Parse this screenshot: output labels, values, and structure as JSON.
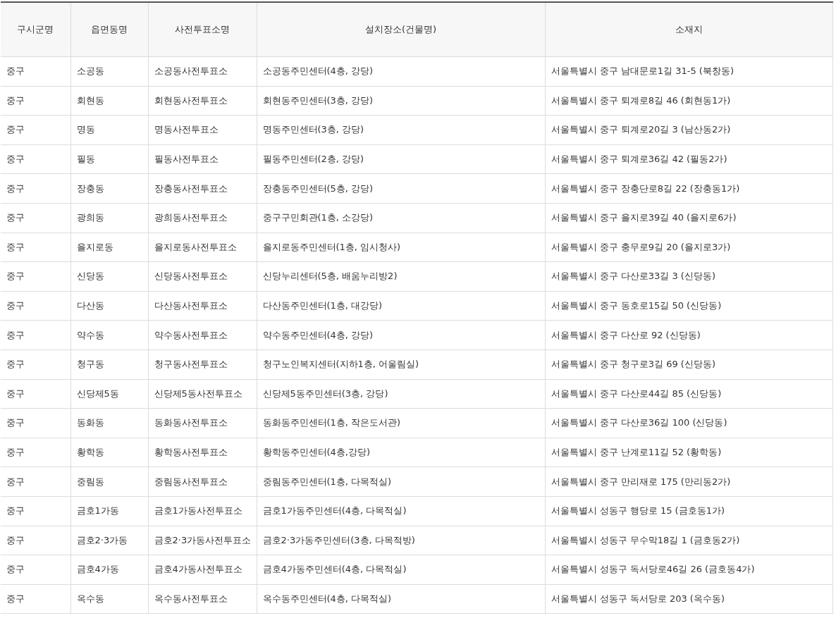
{
  "table": {
    "columns": [
      "구시군명",
      "읍면동명",
      "사전투표소명",
      "설치장소(건물명)",
      "소재지"
    ],
    "rows": [
      [
        "중구",
        "소공동",
        "소공동사전투표소",
        "소공동주민센터(4층, 강당)",
        "서울특별시 중구 남대문로1길 31-5 (북창동)"
      ],
      [
        "중구",
        "회현동",
        "회현동사전투표소",
        "회현동주민센터(3층, 강당)",
        "서울특별시 중구 퇴계로8길 46 (회현동1가)"
      ],
      [
        "중구",
        "명동",
        "명동사전투표소",
        "명동주민센터(3층, 강당)",
        "서울특별시 중구 퇴계로20길 3 (남산동2가)"
      ],
      [
        "중구",
        "필동",
        "필동사전투표소",
        "필동주민센터(2층, 강당)",
        "서울특별시 중구 퇴계로36길 42 (필동2가)"
      ],
      [
        "중구",
        "장충동",
        "장충동사전투표소",
        "장충동주민센터(5층, 강당)",
        "서울특별시 중구 장충단로8길 22 (장충동1가)"
      ],
      [
        "중구",
        "광희동",
        "광희동사전투표소",
        "중구구민회관(1층, 소강당)",
        "서울특별시 중구 을지로39길 40 (을지로6가)"
      ],
      [
        "중구",
        "을지로동",
        "을지로동사전투표소",
        "을지로동주민센터(1층, 임시청사)",
        "서울특별시 중구 충무로9길 20 (을지로3가)"
      ],
      [
        "중구",
        "신당동",
        "신당동사전투표소",
        "신당누리센터(5층, 배움누리방2)",
        "서울특별시 중구 다산로33길 3 (신당동)"
      ],
      [
        "중구",
        "다산동",
        "다산동사전투표소",
        "다산동주민센터(1층, 대강당)",
        "서울특별시 중구 동호로15길 50 (신당동)"
      ],
      [
        "중구",
        "약수동",
        "약수동사전투표소",
        "약수동주민센터(4층, 강당)",
        "서울특별시 중구 다산로 92 (신당동)"
      ],
      [
        "중구",
        "청구동",
        "청구동사전투표소",
        "청구노인복지센터(지하1층, 어울림실)",
        "서울특별시 중구 청구로3길 69 (신당동)"
      ],
      [
        "중구",
        "신당제5동",
        "신당제5동사전투표소",
        "신당제5동주민센터(3층, 강당)",
        "서울특별시 중구 다산로44길 85 (신당동)"
      ],
      [
        "중구",
        "동화동",
        "동화동사전투표소",
        "동화동주민센터(1층, 작은도서관)",
        "서울특별시 중구 다산로36길 100 (신당동)"
      ],
      [
        "중구",
        "황학동",
        "황학동사전투표소",
        "황학동주민센터(4층,강당)",
        "서울특별시 중구 난계로11길 52 (황학동)"
      ],
      [
        "중구",
        "중림동",
        "중림동사전투표소",
        "중림동주민센터(1층, 다목적실)",
        "서울특별시 중구 만리재로 175 (만리동2가)"
      ],
      [
        "중구",
        "금호1가동",
        "금호1가동사전투표소",
        "금호1가동주민센터(4층, 다목적실)",
        "서울특별시 성동구 행당로 15 (금호동1가)"
      ],
      [
        "중구",
        "금호2·3가동",
        "금호2·3가동사전투표소",
        "금호2·3가동주민센터(3층, 다목적방)",
        "서울특별시 성동구 무수막18길 1 (금호동2가)"
      ],
      [
        "중구",
        "금호4가동",
        "금호4가동사전투표소",
        "금호4가동주민센터(4층, 다목적실)",
        "서울특별시 성동구 독서당로46길 26 (금호동4가)"
      ],
      [
        "중구",
        "옥수동",
        "옥수동사전투표소",
        "옥수동주민센터(4층, 다목적실)",
        "서울특별시 성동구 독서당로 203 (옥수동)"
      ]
    ]
  }
}
